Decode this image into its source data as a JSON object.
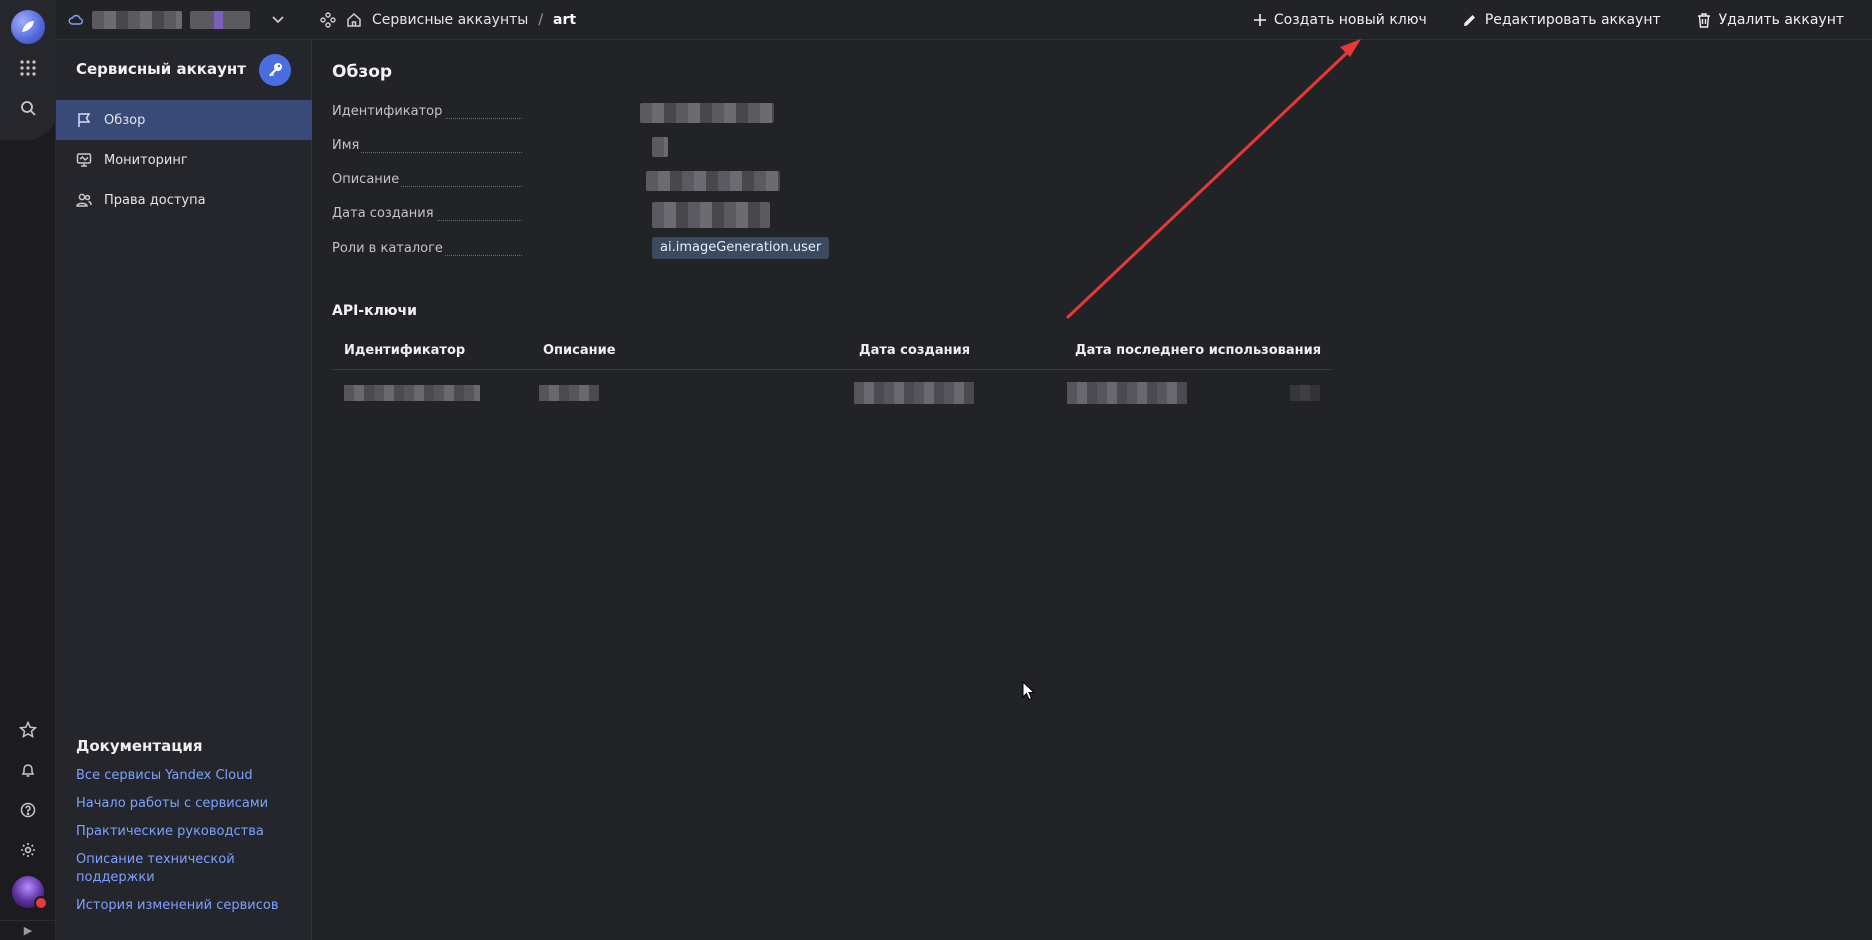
{
  "topbar": {
    "breadcrumbs": [
      "Сервисные аккаунты",
      "/",
      "art"
    ],
    "actions": {
      "create_key": "Создать новый ключ",
      "edit_account": "Редактировать аккаунт",
      "delete_account": "Удалить аккаунт"
    }
  },
  "nav": {
    "title": "Сервисный аккаунт",
    "items": [
      {
        "label": "Обзор",
        "icon": "flag-icon",
        "active": true
      },
      {
        "label": "Мониторинг",
        "icon": "monitor-icon",
        "active": false
      },
      {
        "label": "Права доступа",
        "icon": "users-icon",
        "active": false
      }
    ],
    "docs": {
      "title": "Документация",
      "links": [
        "Все сервисы Yandex Cloud",
        "Начало работы с сервисами",
        "Практические руководства",
        "Описание технической поддержки",
        "История изменений сервисов"
      ]
    }
  },
  "overview": {
    "title": "Обзор",
    "properties": [
      {
        "label": "Идентификатор"
      },
      {
        "label": "Имя"
      },
      {
        "label": "Описание"
      },
      {
        "label": "Дата создания"
      },
      {
        "label": "Роли в каталоге",
        "value": "ai.imageGeneration.user"
      }
    ]
  },
  "api_keys": {
    "title": "API-ключи",
    "columns": [
      "Идентификатор",
      "Описание",
      "Дата создания",
      "Дата последнего использования"
    ]
  },
  "colors": {
    "background": "#222327",
    "accent": "#4a6ee0",
    "link": "#7aa2ff",
    "annotation_arrow": "#e53935"
  }
}
